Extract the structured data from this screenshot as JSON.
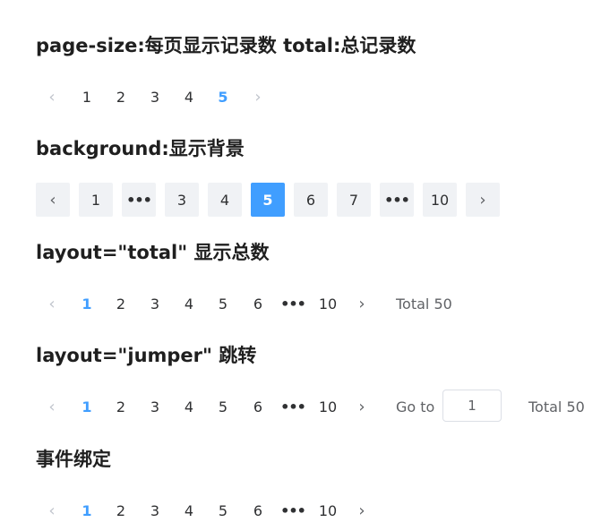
{
  "sections": [
    {
      "title": "page-size:每页显示记录数 total:总记录数"
    },
    {
      "title": "background:显示背景"
    },
    {
      "title": "layout=\"total\" 显示总数"
    },
    {
      "title": "layout=\"jumper\" 跳转"
    },
    {
      "title": "事件绑定"
    }
  ],
  "pager1": {
    "prev": "‹",
    "pages": [
      "1",
      "2",
      "3",
      "4",
      "5"
    ],
    "next": "›",
    "current": "5"
  },
  "pager2": {
    "prev": "‹",
    "pages": [
      "1",
      "•••",
      "3",
      "4",
      "5",
      "6",
      "7",
      "•••",
      "10"
    ],
    "next": "›",
    "current": "5"
  },
  "pager3": {
    "prev": "‹",
    "pages": [
      "1",
      "2",
      "3",
      "4",
      "5",
      "6",
      "•••",
      "10"
    ],
    "next": "›",
    "current": "1",
    "total_label": "Total 50"
  },
  "pager4": {
    "prev": "‹",
    "pages": [
      "1",
      "2",
      "3",
      "4",
      "5",
      "6",
      "•••",
      "10"
    ],
    "next": "›",
    "current": "1",
    "goto_label": "Go to",
    "goto_value": "1",
    "total_label": "Total 50"
  },
  "pager5": {
    "prev": "‹",
    "pages": [
      "1",
      "2",
      "3",
      "4",
      "5",
      "6",
      "•••",
      "10"
    ],
    "next": "›",
    "current": "1"
  },
  "colors": {
    "accent": "#409eff",
    "bg_item": "#f0f2f5",
    "text": "#303133",
    "disabled": "#c0c4cc"
  }
}
